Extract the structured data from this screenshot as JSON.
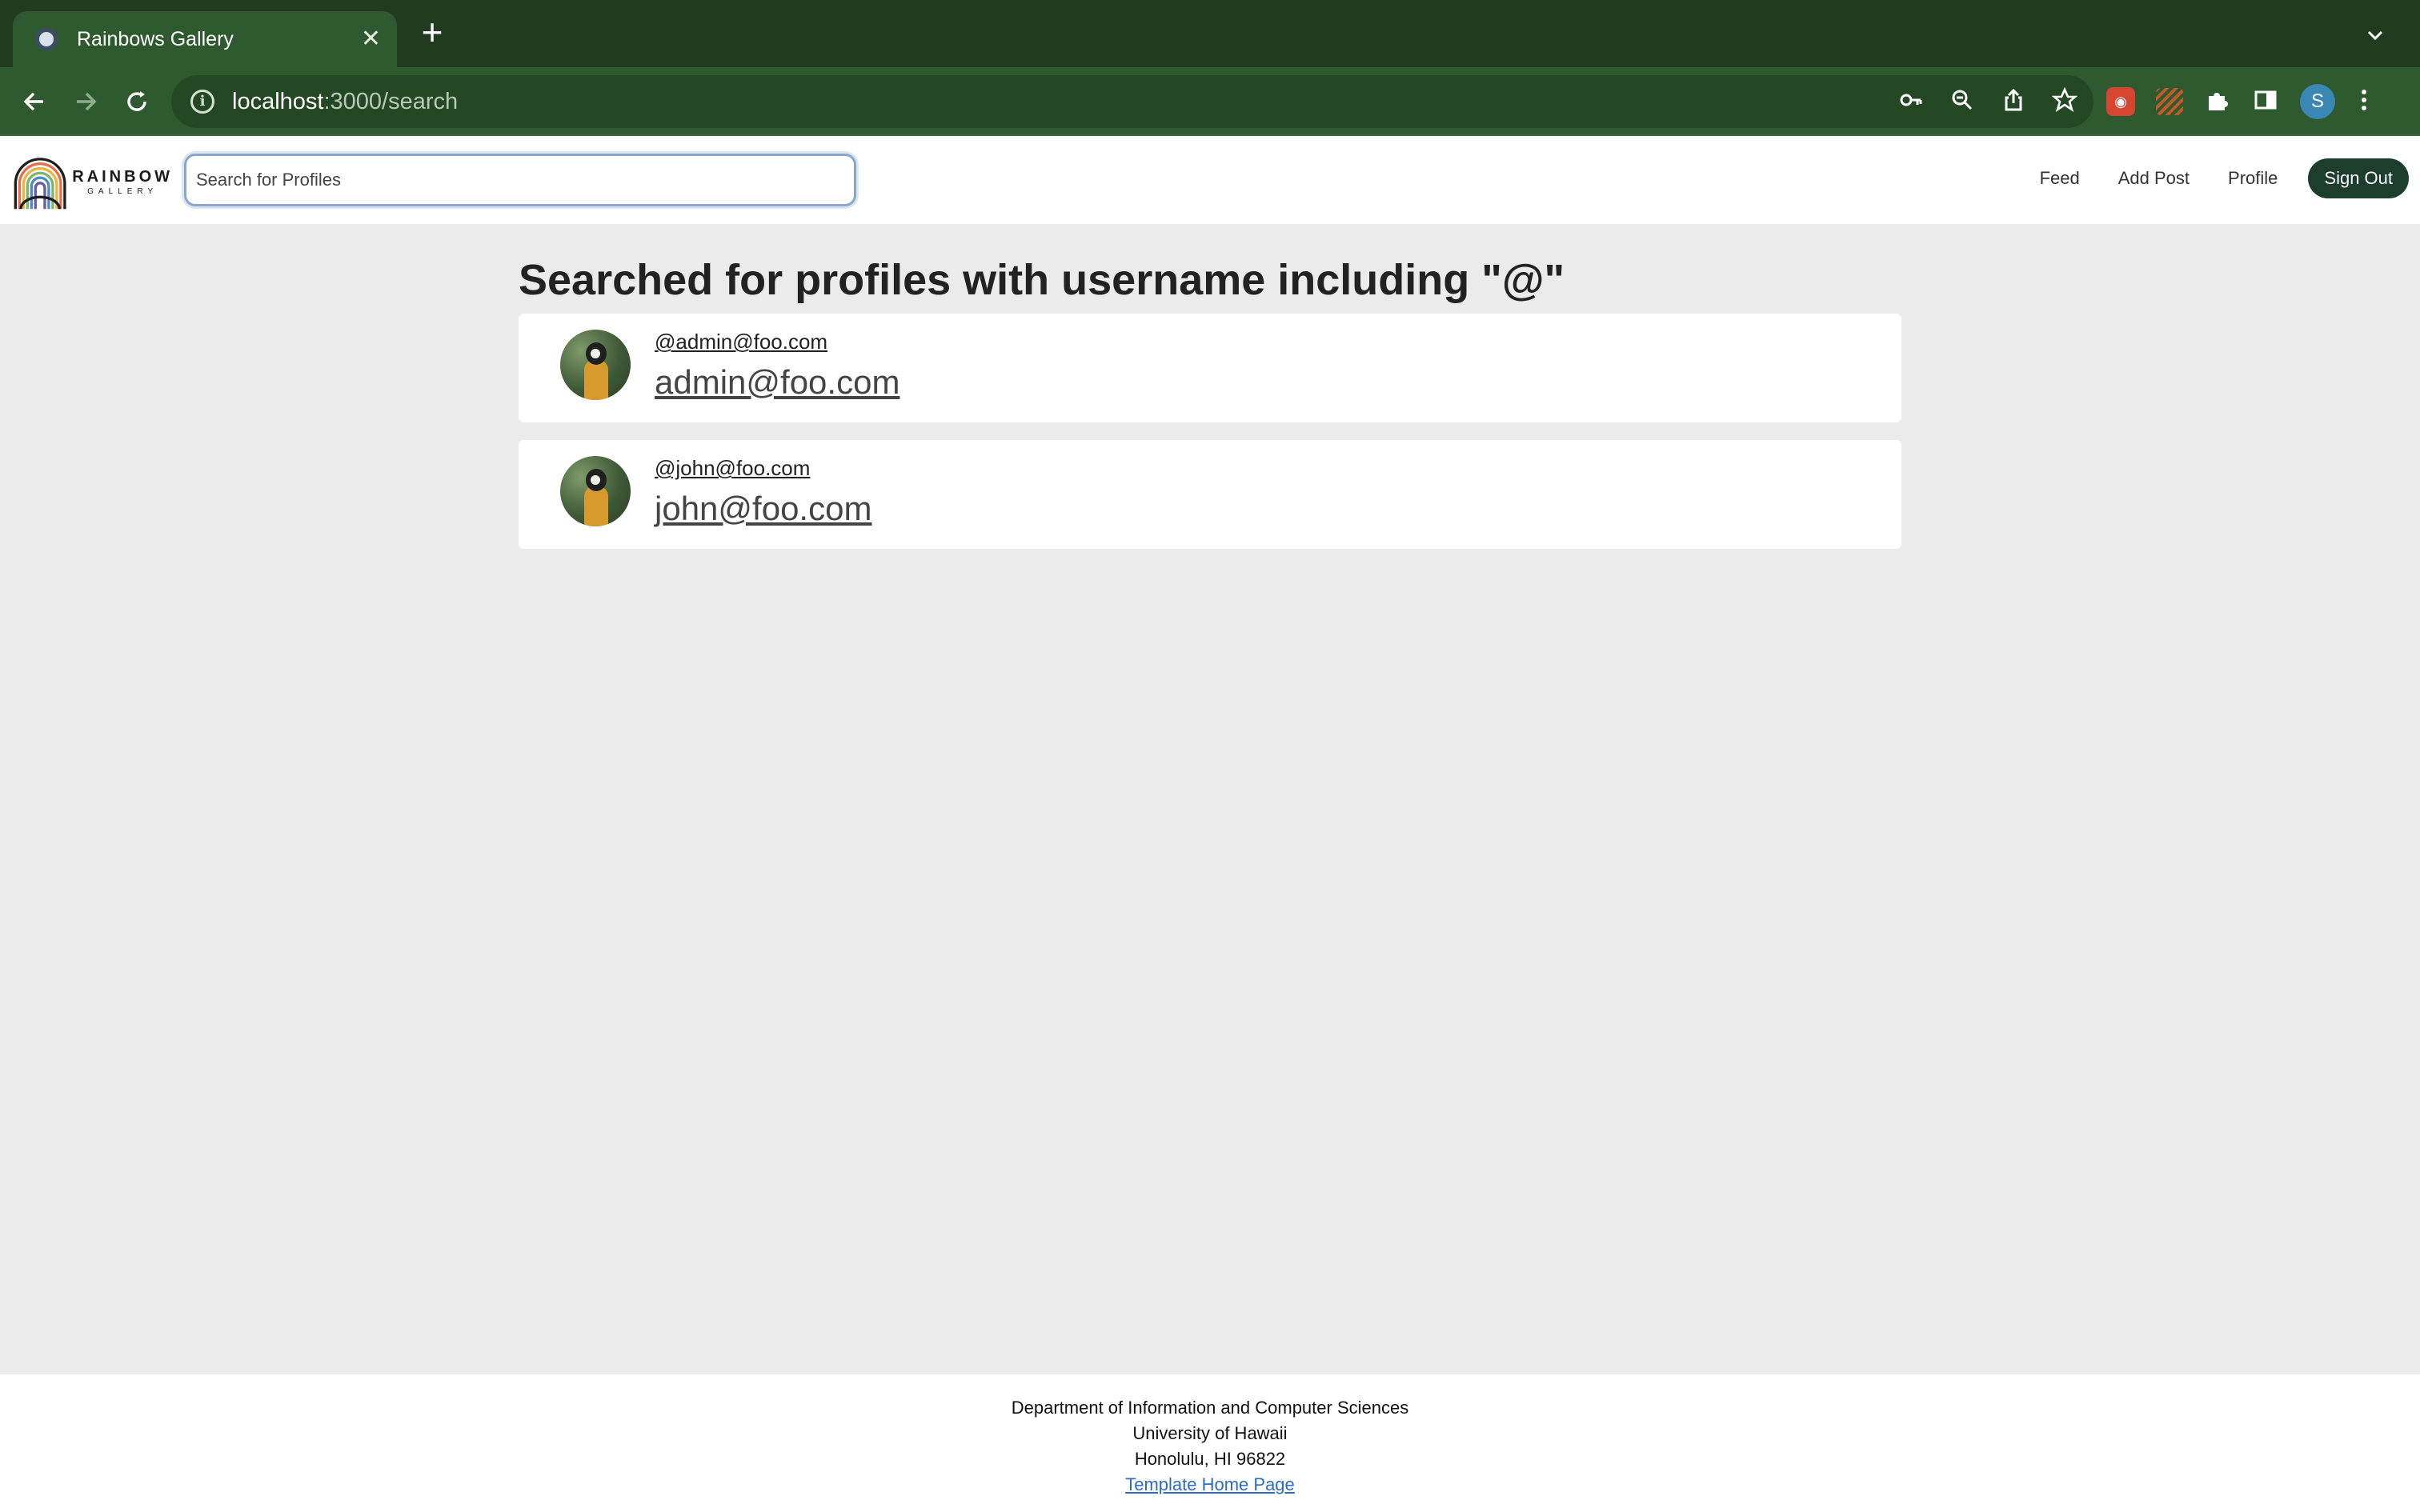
{
  "browser": {
    "tab_title": "Rainbows Gallery",
    "url_host": "localhost",
    "url_path": ":3000/search",
    "profile_initial": "S"
  },
  "navbar": {
    "logo_text": "RAINBOW",
    "logo_subtext": "GALLERY",
    "search_placeholder": "Search for Profiles",
    "links": [
      "Feed",
      "Add Post",
      "Profile"
    ],
    "signout_label": "Sign Out"
  },
  "main": {
    "heading": "Searched for profiles with username including \"@\"",
    "results": [
      {
        "handle": "@admin@foo.com",
        "name": "admin@foo.com"
      },
      {
        "handle": "@john@foo.com",
        "name": "john@foo.com"
      }
    ]
  },
  "footer": {
    "line1": "Department of Information and Computer Sciences",
    "line2": "University of Hawaii",
    "line3": "Honolulu, HI 96822",
    "link": "Template Home Page"
  },
  "colors": {
    "chrome_dark": "#213b21",
    "chrome_toolbar": "#2f5a2f",
    "signout_bg": "#1d3e2c",
    "page_bg": "#ebebeb"
  }
}
